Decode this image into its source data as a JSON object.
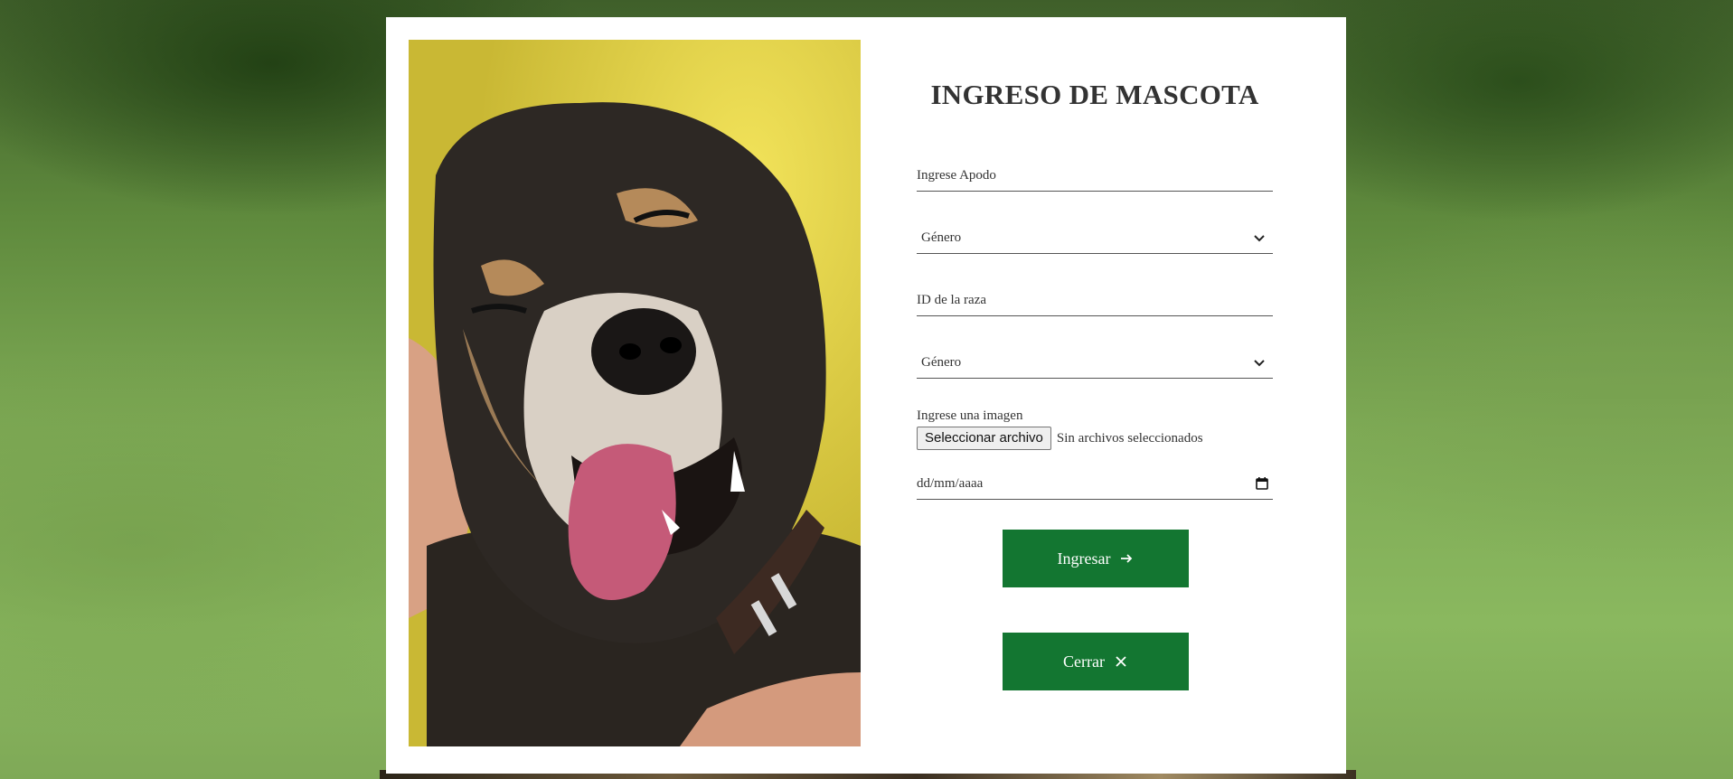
{
  "form": {
    "title": "INGRESO DE MASCOTA",
    "nickname_placeholder": "Ingrese Apodo",
    "gender_select_1": "Género",
    "breed_id_placeholder": "ID de la raza",
    "gender_select_2": "Género",
    "image_label": "Ingrese una imagen",
    "file_button": "Seleccionar archivo",
    "file_status": "Sin archivos seleccionados",
    "date_placeholder": "dd/mm/aaaa",
    "submit_label": "Ingresar",
    "close_label": "Cerrar"
  },
  "icons": {
    "submit": "arrow-right-icon",
    "close": "close-icon",
    "select": "chevron-down-icon",
    "date": "calendar-icon"
  },
  "colors": {
    "button_bg": "#137631",
    "button_text": "#ffffff",
    "card_bg": "#ffffff",
    "title": "#333333"
  }
}
